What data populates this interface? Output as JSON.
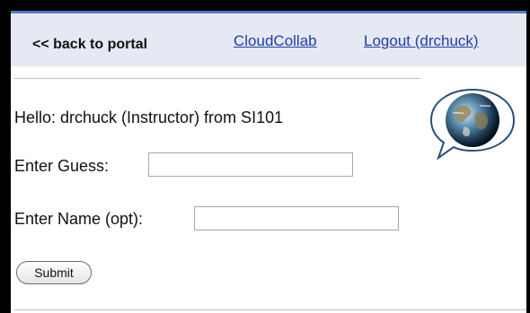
{
  "nav": {
    "back_label": "<< back to portal",
    "cloud_label": "CloudCollab",
    "logout_label": "Logout (drchuck)"
  },
  "main": {
    "greeting": "Hello: drchuck (Instructor) from SI101",
    "guess_label": "Enter Guess:",
    "guess_value": "",
    "name_label": "Enter Name (opt):",
    "name_value": "",
    "submit_label": "Submit"
  },
  "icons": {
    "logo": "globe-speech-bubble-icon"
  },
  "colors": {
    "nav_background": "#e6e8f3",
    "accent_rule": "#4f7fc6",
    "link": "#1f3fa6"
  }
}
